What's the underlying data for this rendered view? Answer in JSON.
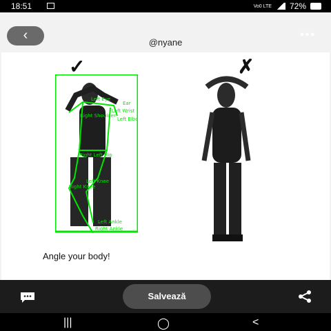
{
  "status": {
    "time": "18:51",
    "battery": "72%",
    "network_small": "Vo0 LTE"
  },
  "header": {
    "username": "@nyane",
    "more": "•••"
  },
  "icons": {
    "back": "‹",
    "check": "✓",
    "cross": "✗",
    "recents": "|||",
    "home": "◯",
    "nav_back": "<"
  },
  "pose_labels": [
    "Left Eye",
    "Ear",
    "Left Wrist",
    "Right Shoulder",
    "Left Elbow",
    "Right Left Hip",
    "Left Knee",
    "Right Knee",
    "Left Ankle",
    "Right Ankle"
  ],
  "instruction": "Angle your body!",
  "bottom": {
    "save_label": "Salvează"
  }
}
